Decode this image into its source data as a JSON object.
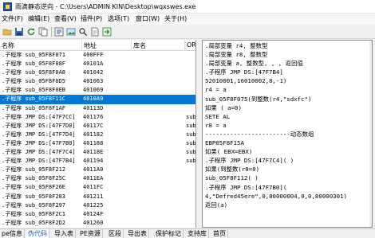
{
  "window": {
    "title": "雨滴静态逆向 - C:\\Users\\ADMIN KIN\\Desktop\\wqxswes.exe"
  },
  "menu": [
    "文件(F)",
    "编辑(E)",
    "查看(V)",
    "插件(P)",
    "选项(T)",
    "窗口(W)",
    "关于(H)"
  ],
  "toolbar": {
    "buttons": [
      "open-icon",
      "save-icon",
      "refresh-icon",
      "copy-icon",
      "export-icon",
      "image-icon",
      "search-icon",
      "document-icon",
      "jump-icon"
    ]
  },
  "columns": {
    "name": "名称",
    "address": "地址",
    "library": "库名",
    "extra": "OR"
  },
  "rows": [
    {
      "name": ".子程序 sub_05F8F071",
      "address": "400FFF",
      "extra": ""
    },
    {
      "name": ".子程序 sub_05F8F08F",
      "address": "40101A",
      "extra": ""
    },
    {
      "name": ".子程序 sub_05F8F0A8",
      "address": "401042",
      "extra": ""
    },
    {
      "name": ".子程序 sub_05F8F0D5",
      "address": "401063",
      "extra": ""
    },
    {
      "name": ".子程序 sub_05F8F0EB",
      "address": "401069",
      "extra": ""
    },
    {
      "name": ".子程序 sub_05F8F11C",
      "address": "4010A9",
      "extra": ""
    },
    {
      "name": ".子程序 sub_05F8F1AF",
      "address": "40113D",
      "extra": ""
    },
    {
      "name": ".子程序 JMP DS:[47F7CC]",
      "address": "401176",
      "extra": "sub"
    },
    {
      "name": ".子程序 JMP DS:[47F7D0]",
      "address": "40117C",
      "extra": "sub"
    },
    {
      "name": ".子程序 JMP DS:[47F7D4]",
      "address": "401182",
      "extra": "sub"
    },
    {
      "name": ".子程序 JMP DS:[47F7B0]",
      "address": "401188",
      "extra": "sub"
    },
    {
      "name": ".子程序 JMP DS:[47F7C4]",
      "address": "40118E",
      "extra": "sub"
    },
    {
      "name": ".子程序 JMP DS:[47F7B4]",
      "address": "401194",
      "extra": "sub"
    },
    {
      "name": ".子程序 sub_05F8F212",
      "address": "4011A0",
      "extra": ""
    },
    {
      "name": ".子程序 sub_05F8F25C",
      "address": "4011EA",
      "extra": ""
    },
    {
      "name": ".子程序 sub_05F8F26E",
      "address": "4011FC",
      "extra": ""
    },
    {
      "name": ".子程序 sub_05F8F283",
      "address": "401211",
      "extra": ""
    },
    {
      "name": ".子程序 sub_05F8F297",
      "address": "401225",
      "extra": ""
    },
    {
      "name": ".子程序 sub_05F8F2C1",
      "address": "40124F",
      "extra": ""
    },
    {
      "name": ".子程序 sub_05F8F2D2",
      "address": "401260",
      "extra": ""
    }
  ],
  "selected_row": 5,
  "code_lines": [
    ".局部变量  r4, 整数型",
    ".局部变量  r8, 整数型",
    ".局部变量  a, 整数型, , , 返回值",
    ".子程序 JMP DS:[47F7B4]",
    "52010001,16010002,8,-1)",
    " r4 = a",
    "sub_05F8F075(到整数(r4,\"sdxfc\")",
    "如果 ( a=0)",
    "SETE AL",
    " r8 = a",
    "------------------------动态数组",
    "EBP05F8F15A",
    "如果( EBX=EBX)",
    ".子程序 JMP DS:[47F7C4]( )",
    "如果(到整数(r8=0)",
    "sub_05F8F112( )",
    ".子程序 JMP DS:[47F7B0](",
    "4,\"Defred45ere\",0,80000004,0,0,80000301)",
    "返回(a)"
  ],
  "tabs": [
    "pe信息",
    "伪代码",
    "导入表",
    "PE资源",
    "区段",
    "导出表",
    "保护标记",
    "支持库",
    "首页"
  ],
  "active_tab": 1
}
